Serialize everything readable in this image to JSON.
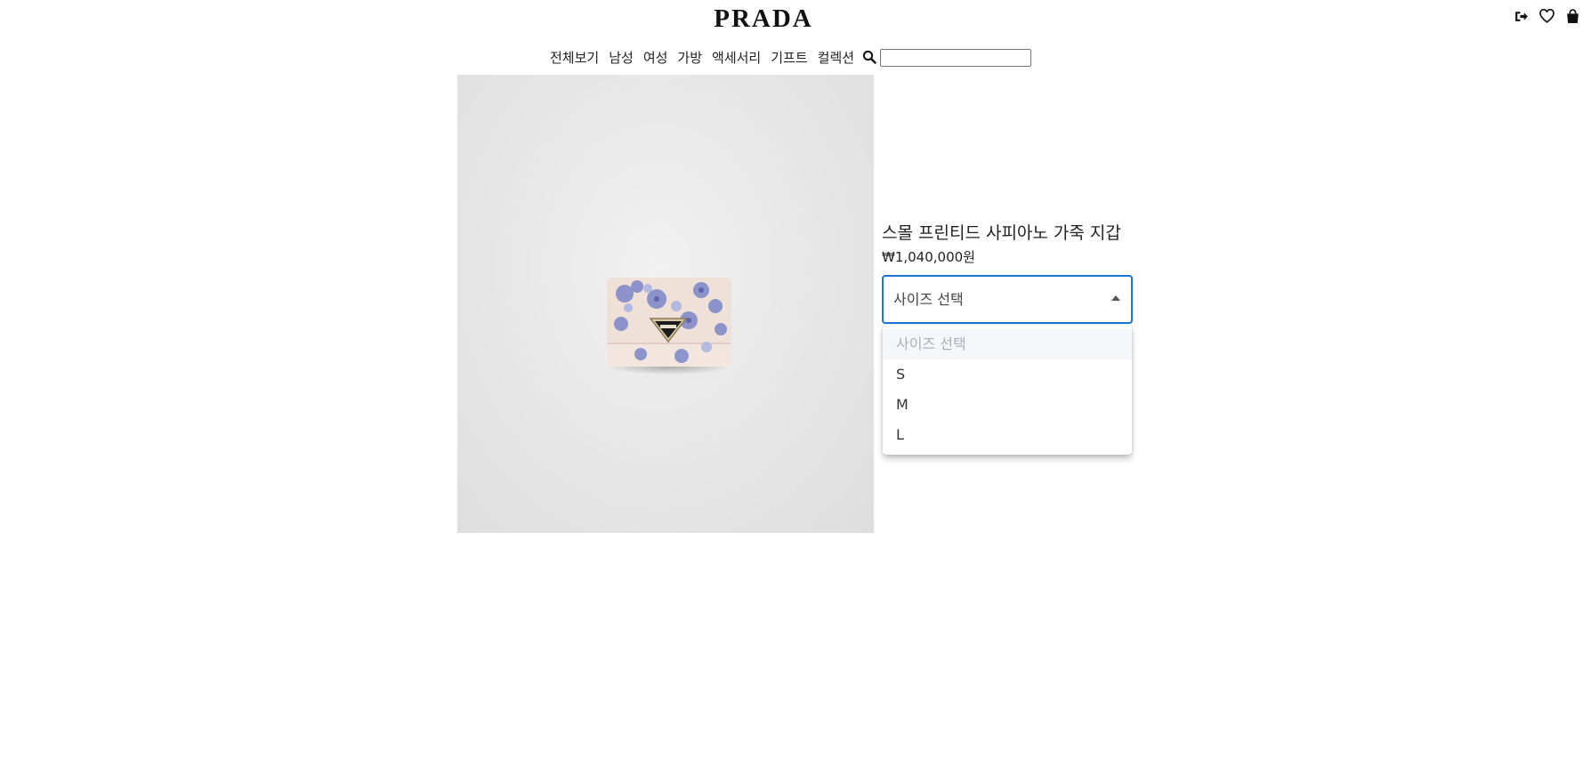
{
  "header": {
    "logo": "PRADA",
    "icons": [
      "logout-icon",
      "heart-icon",
      "shopping-bag-icon"
    ]
  },
  "nav": {
    "items": [
      "전체보기",
      "남성",
      "여성",
      "가방",
      "액세서리",
      "기프트",
      "컬렉션"
    ],
    "search_placeholder": "",
    "search_value": ""
  },
  "product": {
    "name": "스몰 프린티드 사피아노 가죽 지갑",
    "price": "₩1,040,000원",
    "image_alt": "wallet"
  },
  "size_select": {
    "selected": "사이즈 선택",
    "options": [
      "사이즈 선택",
      "S",
      "M",
      "L"
    ]
  },
  "colors": {
    "accent": "#1976d2",
    "text": "#222222",
    "background": "#ffffff",
    "disabled_option": "#aab0b8"
  }
}
